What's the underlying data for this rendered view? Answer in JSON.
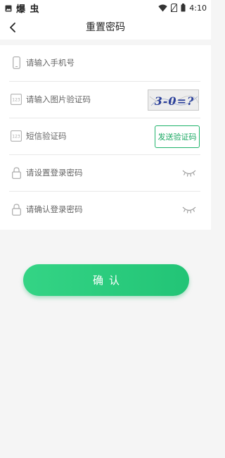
{
  "status_bar": {
    "app_label": "爆 虫",
    "time": "4:10",
    "icons": [
      "image-icon",
      "wifi-icon",
      "no-sim-icon",
      "battery-icon"
    ]
  },
  "nav": {
    "title": "重置密码",
    "back_icon": "chevron-left-icon"
  },
  "form": {
    "phone": {
      "placeholder": "请输入手机号",
      "value": "",
      "icon": "phone-icon"
    },
    "image_captcha": {
      "placeholder": "请输入图片验证码",
      "value": "",
      "icon": "numeric-123-icon",
      "captcha_text": "3-0=?"
    },
    "sms_code": {
      "placeholder": "短信验证码",
      "value": "",
      "icon": "numeric-123-icon",
      "send_button_label": "发送验证码"
    },
    "password": {
      "placeholder": "请设置登录密码",
      "value": "",
      "icon": "lock-icon",
      "toggle_icon": "eye-closed-icon"
    },
    "confirm_password": {
      "placeholder": "请确认登录密码",
      "value": "",
      "icon": "lock-icon",
      "toggle_icon": "eye-closed-icon"
    }
  },
  "confirm_button_label": "确认",
  "colors": {
    "accent": "#22c476",
    "accent_dark": "#1aa862",
    "background": "#f5f5f5",
    "panel": "#ffffff"
  }
}
